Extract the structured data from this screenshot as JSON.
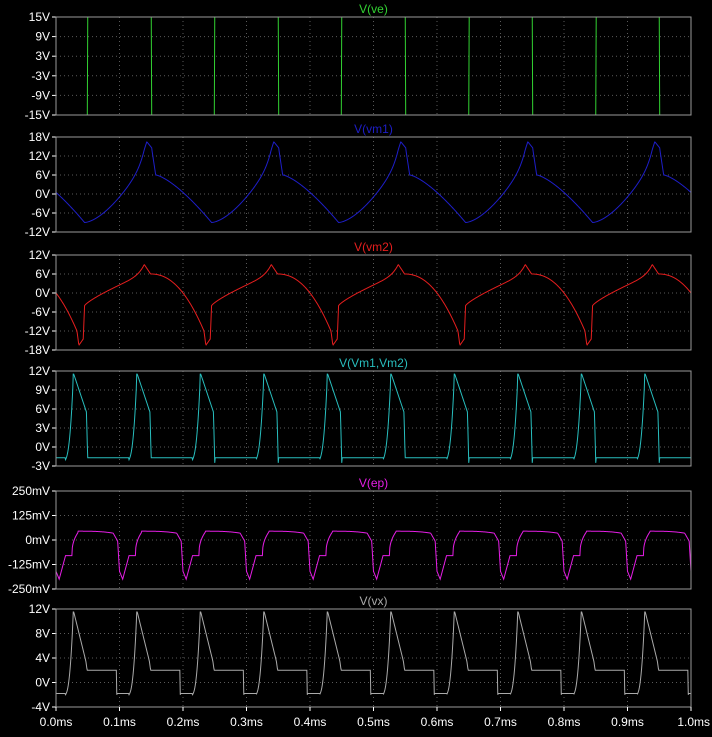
{
  "window": {
    "background": "#000000",
    "grid_color": "#5a5a5a",
    "frame_color": "#9a9a9a",
    "tick_color": "#ffffff"
  },
  "x_axis": {
    "range": [
      0,
      1.0
    ],
    "unit": "ms",
    "ticks": [
      "0.0ms",
      "0.1ms",
      "0.2ms",
      "0.3ms",
      "0.4ms",
      "0.5ms",
      "0.6ms",
      "0.7ms",
      "0.8ms",
      "0.9ms",
      "1.0ms"
    ]
  },
  "chart_data": [
    {
      "type": "line",
      "title": "V(ve)",
      "color": "#32d232",
      "ylim": [
        -15,
        15
      ],
      "yticks": [
        "15V",
        "9V",
        "3V",
        "-3V",
        "-9V",
        "-15V"
      ],
      "ytick_values": [
        15,
        9,
        3,
        -3,
        -9,
        -15
      ],
      "series": [
        {
          "shape": "square",
          "period_ms": 0.2,
          "high": 15,
          "low": -15,
          "first_rise_ms": 0.05
        }
      ]
    },
    {
      "type": "line",
      "title": "V(vm1)",
      "color": "#1e1ec8",
      "ylim": [
        -12,
        18
      ],
      "yticks": [
        "18V",
        "12V",
        "6V",
        "0V",
        "-6V",
        "-12V"
      ],
      "ytick_values": [
        18,
        12,
        6,
        0,
        -6,
        -12
      ],
      "series": [
        {
          "period_ms": 0.2,
          "peak": 16.5,
          "trough": -9,
          "start": -2
        }
      ]
    },
    {
      "type": "line",
      "title": "V(vm2)",
      "color": "#e61e1e",
      "ylim": [
        -18,
        12
      ],
      "yticks": [
        "12V",
        "6V",
        "0V",
        "-6V",
        "-12V",
        "-18V"
      ],
      "ytick_values": [
        12,
        6,
        0,
        -6,
        -12,
        -18
      ],
      "series": [
        {
          "period_ms": 0.2,
          "peak": 9,
          "trough": -16.5,
          "start": 0
        }
      ]
    },
    {
      "type": "line",
      "title": "V(Vm1,Vm2)",
      "color": "#28bebe",
      "ylim": [
        -3,
        12
      ],
      "yticks": [
        "12V",
        "9V",
        "6V",
        "3V",
        "0V",
        "-3V"
      ],
      "ytick_values": [
        12,
        9,
        6,
        3,
        0,
        -3
      ],
      "series": [
        {
          "period_ms": 0.1,
          "peak": 11.5,
          "baseline": -2
        }
      ]
    },
    {
      "type": "line",
      "title": "V(ep)",
      "color": "#e61ee6",
      "ylim": [
        -250,
        250
      ],
      "yticks": [
        "250mV",
        "125mV",
        "0mV",
        "-125mV",
        "-250mV"
      ],
      "ytick_values": [
        250,
        125,
        0,
        -125,
        -250
      ],
      "series": [
        {
          "period_ms": 0.1,
          "high": 45,
          "low": -200
        }
      ]
    },
    {
      "type": "line",
      "title": "V(vx)",
      "color": "#aaaaaa",
      "ylim": [
        -4,
        12
      ],
      "yticks": [
        "12V",
        "8V",
        "4V",
        "0V",
        "-4V"
      ],
      "ytick_values": [
        12,
        8,
        4,
        0,
        -4
      ],
      "series": [
        {
          "period_ms": 0.1,
          "peak": 11.5,
          "plateau": 2,
          "baseline": -2
        }
      ]
    }
  ]
}
